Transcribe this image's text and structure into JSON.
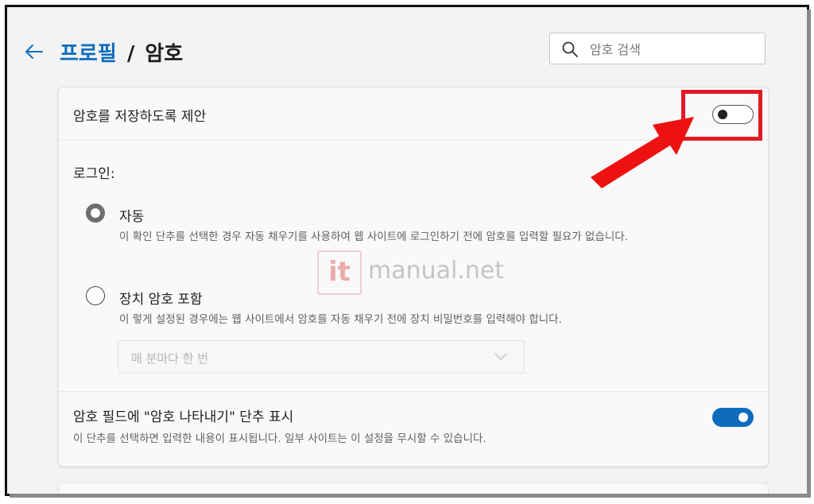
{
  "header": {
    "breadcrumb_parent": "프로필",
    "breadcrumb_separator": "/",
    "breadcrumb_current": "암호"
  },
  "search": {
    "placeholder": "암호 검색"
  },
  "offer_save": {
    "label": "암호를 저장하도록 제안",
    "enabled": false
  },
  "signin": {
    "label": "로그인:",
    "options": [
      {
        "title": "자동",
        "description": "이 확인 단추를 선택한 경우 자동 채우기를 사용하여 웹 사이트에 로그인하기 전에 암호를 입력할 필요가 없습니다.",
        "selected": true
      },
      {
        "title": "장치 암호 포함",
        "description": "이 렇게 설정된 경우에는 웹 사이트에서 암호를 자동 채우기 전에 장치 비밀번호를 입력해야 합니다.",
        "selected": false
      }
    ],
    "frequency_select": {
      "value": "매 분마다 한 번"
    }
  },
  "reveal_button": {
    "title": "암호 필드에 \"암호 나타내기\" 단추 표시",
    "description": "이 단추를 선택하면 입력한 내용이 표시됩니다. 일부 사이트는 이 설정을 무시할 수 있습니다.",
    "enabled": true
  },
  "watermark": {
    "logo": "it",
    "text": "manual.net"
  },
  "colors": {
    "accent": "#0f6cbd",
    "highlight": "#e01b24",
    "background": "#f3f3f3"
  }
}
